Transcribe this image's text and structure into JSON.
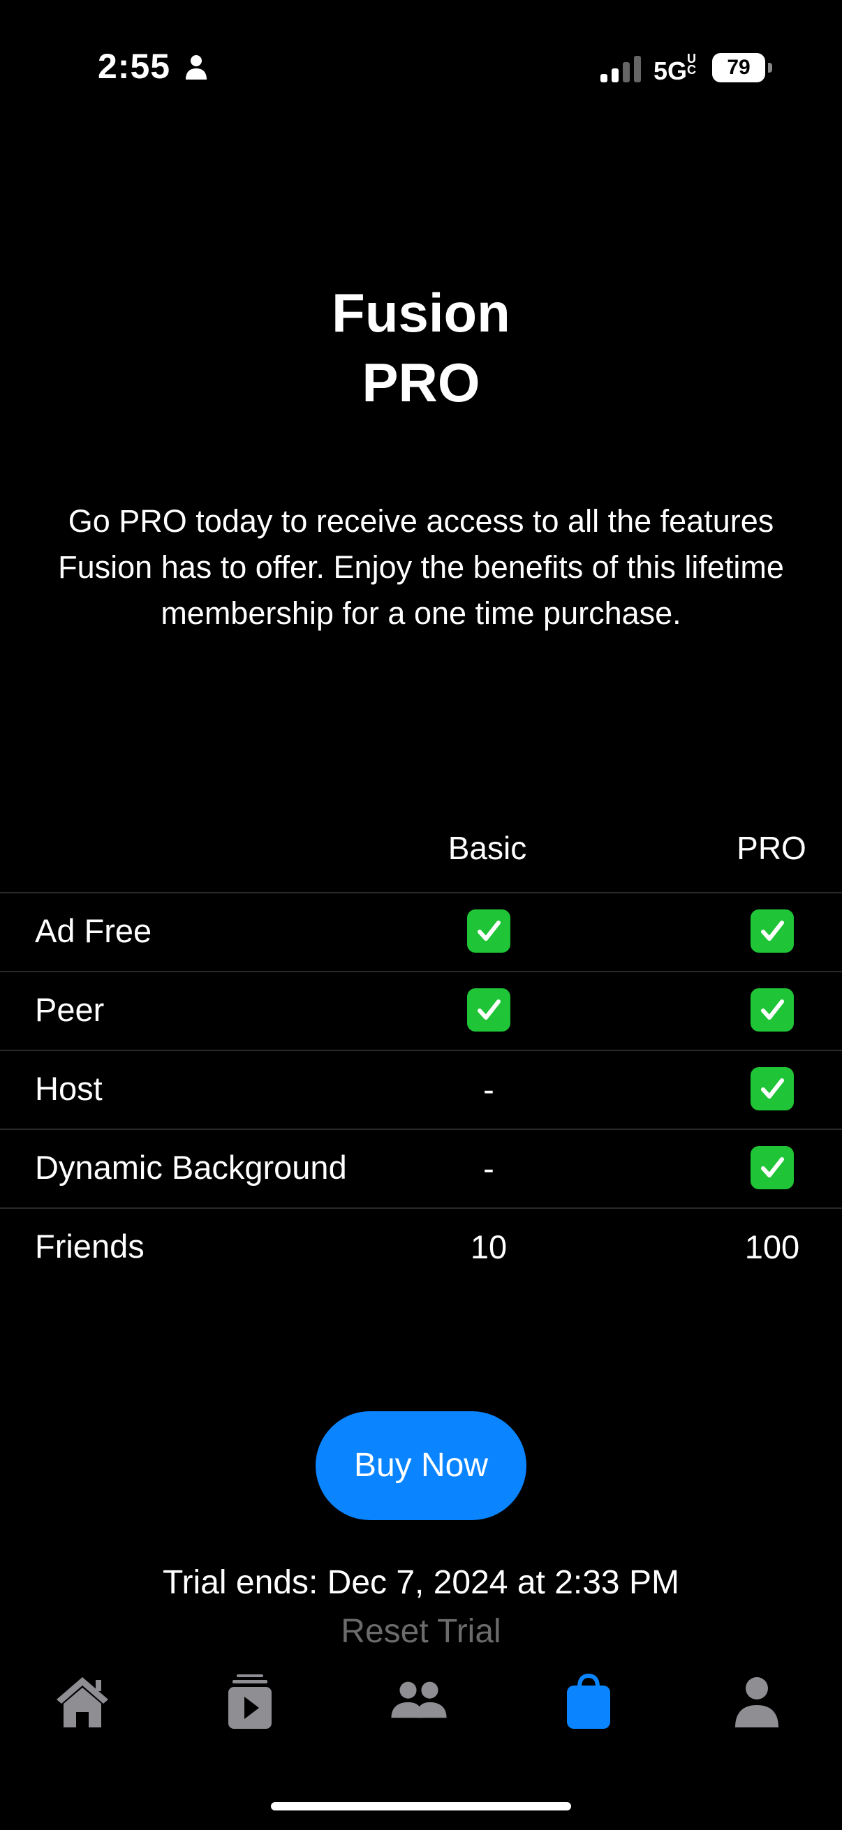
{
  "status_bar": {
    "time": "2:55",
    "network": "5GUC",
    "network_main": "5G",
    "network_super": "UC",
    "battery": "79",
    "person_icon": "person-icon",
    "signal_icon": "signal-icon"
  },
  "header": {
    "title_line1": "Fusion",
    "title_line2": "PRO"
  },
  "description": "Go PRO today to receive access to all the features Fusion has to offer. Enjoy the benefits of this lifetime membership for a one time purchase.",
  "table": {
    "columns": [
      "Basic",
      "PRO"
    ],
    "rows": [
      {
        "label": "Ad Free",
        "basic": "check",
        "pro": "check"
      },
      {
        "label": "Peer",
        "basic": "check",
        "pro": "check"
      },
      {
        "label": "Host",
        "basic": "-",
        "pro": "check"
      },
      {
        "label": "Dynamic Background",
        "basic": "-",
        "pro": "check"
      },
      {
        "label": "Friends",
        "basic": "10",
        "pro": "100"
      }
    ]
  },
  "buy_button": "Buy Now",
  "trial_text": "Trial ends: Dec 7, 2024 at 2:33 PM",
  "reset_trial": "Reset Trial",
  "tabbar": {
    "tabs": [
      {
        "name": "home",
        "icon": "house-icon",
        "active": false
      },
      {
        "name": "media",
        "icon": "play-stack-icon",
        "active": false
      },
      {
        "name": "friends",
        "icon": "people-icon",
        "active": false
      },
      {
        "name": "store",
        "icon": "bag-icon",
        "active": true
      },
      {
        "name": "profile",
        "icon": "person-icon",
        "active": false
      }
    ]
  },
  "colors": {
    "accent": "#0a84ff",
    "check_green": "#1fc437",
    "inactive_icon": "#8e8e93",
    "reset_gray": "#6b6b6b"
  }
}
